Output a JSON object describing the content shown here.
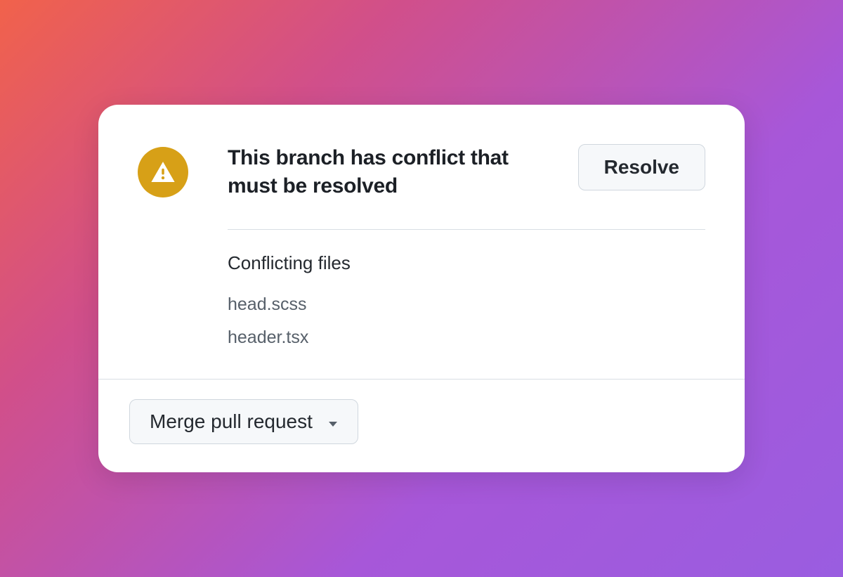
{
  "conflict": {
    "title": "This branch has conflict that must be resolved",
    "resolve_label": "Resolve",
    "subheading": "Conflicting files",
    "files": [
      "head.scss",
      "header.tsx"
    ]
  },
  "footer": {
    "merge_label": "Merge pull request"
  }
}
